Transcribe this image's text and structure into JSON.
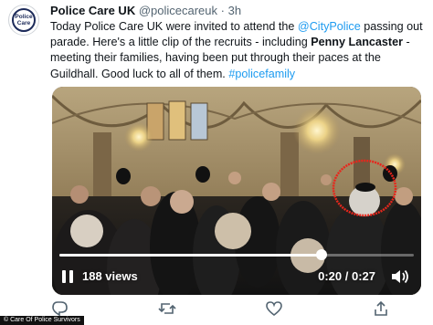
{
  "tweet": {
    "avatar_text_line1": "Police",
    "avatar_text_line2": "Care",
    "author_name": "Police Care UK",
    "author_handle": "@policecareuk",
    "separator": "·",
    "time": "3h",
    "text_1": "Today Police Care UK were invited to attend the ",
    "mention": "@CityPolice",
    "text_2": " passing out parade. Here's a little clip of the recruits -  including ",
    "bold_name": "Penny Lancaster",
    "text_3": " - meeting their families, having been put through their paces at the Guildhall. Good luck to all of them. ",
    "hashtag": "#policefamily"
  },
  "video": {
    "views": "188 views",
    "time_display": "0:20 / 0:27",
    "progress": 0.74,
    "annotation": "red circle"
  },
  "actions": {
    "icons": [
      "reply-icon",
      "retweet-icon",
      "like-icon",
      "share-icon"
    ]
  },
  "caption": "© Care Of Police Survivors",
  "colors": {
    "link": "#1d9bf0",
    "text": "#0f1419",
    "muted": "#536471",
    "annotation": "#e8261c"
  }
}
